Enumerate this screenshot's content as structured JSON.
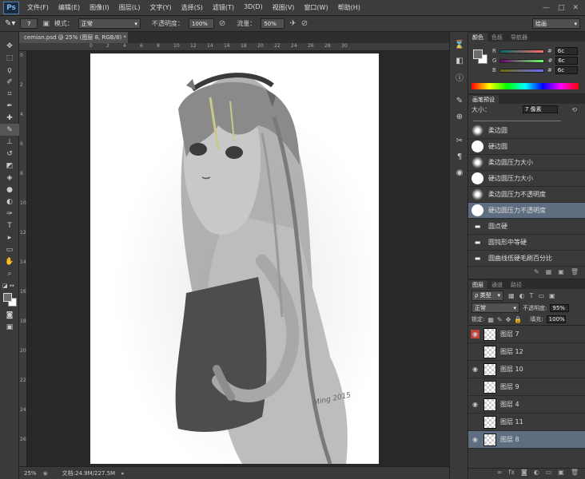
{
  "app": {
    "logo": "Ps"
  },
  "menu": [
    "文件(F)",
    "编辑(E)",
    "图像(I)",
    "图层(L)",
    "文字(Y)",
    "选择(S)",
    "滤镜(T)",
    "3D(D)",
    "视图(V)",
    "窗口(W)",
    "帮助(H)"
  ],
  "window_controls": {
    "min": "—",
    "max": "□",
    "close": "✕"
  },
  "options": {
    "brush_size": "7",
    "mode_label": "模式：",
    "mode_value": "正常",
    "opacity_label": "不透明度：",
    "opacity_value": "100%",
    "flow_label": "流量：",
    "flow_value": "50%",
    "workspace": "绘画"
  },
  "document": {
    "tab_title": "cemian.psd @ 25% (图层 8, RGB/8) *",
    "close": "×"
  },
  "ruler": {
    "top": [
      "0",
      "2",
      "4",
      "6",
      "8",
      "10",
      "12",
      "14",
      "16",
      "18",
      "20",
      "22",
      "24",
      "26",
      "28",
      "30"
    ],
    "left": [
      "0",
      "2",
      "4",
      "6",
      "8",
      "10",
      "12",
      "14",
      "16",
      "18",
      "20",
      "22",
      "24",
      "26"
    ]
  },
  "status": {
    "zoom": "25%",
    "doc_info": "文档:24.9M/227.5M"
  },
  "color_panel": {
    "tabs": [
      "颜色",
      "色板",
      "导航器"
    ],
    "channels": [
      {
        "name": "R",
        "value": "6c"
      },
      {
        "name": "G",
        "value": "6c"
      },
      {
        "name": "B",
        "value": "6c"
      }
    ],
    "hash": "#",
    "fg_color": "#6c6c6c",
    "bg_color": "#ffffff"
  },
  "brush_panel": {
    "tabs": [
      "画笔预设"
    ],
    "size_label": "大小：",
    "size_value": "7 像素",
    "items": [
      {
        "label": "柔边圆",
        "kind": "soft"
      },
      {
        "label": "硬边圆",
        "kind": "hard"
      },
      {
        "label": "柔边圆压力大小",
        "kind": "soft"
      },
      {
        "label": "硬边圆压力大小",
        "kind": "hard"
      },
      {
        "label": "柔边圆压力不透明度",
        "kind": "soft"
      },
      {
        "label": "硬边圆压力不透明度",
        "kind": "hard",
        "selected": true
      },
      {
        "label": "圆点硬",
        "kind": "tip"
      },
      {
        "label": "圆钝形中等硬",
        "kind": "tip"
      },
      {
        "label": "圆曲线低硬毛刷百分比",
        "kind": "tip"
      }
    ]
  },
  "layers_panel": {
    "tabs": [
      "图层",
      "通道",
      "路径"
    ],
    "filter": "ρ 类型",
    "blend": "正常",
    "opacity_label": "不透明度:",
    "opacity_value": "95%",
    "lock_label": "锁定:",
    "fill_label": "填充:",
    "fill_value": "100%",
    "layers": [
      {
        "name": "图层 7",
        "visible": true,
        "highlight": "#c0403a"
      },
      {
        "name": "图层 12",
        "visible": false
      },
      {
        "name": "图层 10",
        "visible": true
      },
      {
        "name": "图层 9",
        "visible": false
      },
      {
        "name": "图层 4",
        "visible": true
      },
      {
        "name": "图层 11",
        "visible": false
      },
      {
        "name": "图层 8",
        "visible": true,
        "selected": true
      }
    ]
  },
  "signature": "Ming 2015"
}
